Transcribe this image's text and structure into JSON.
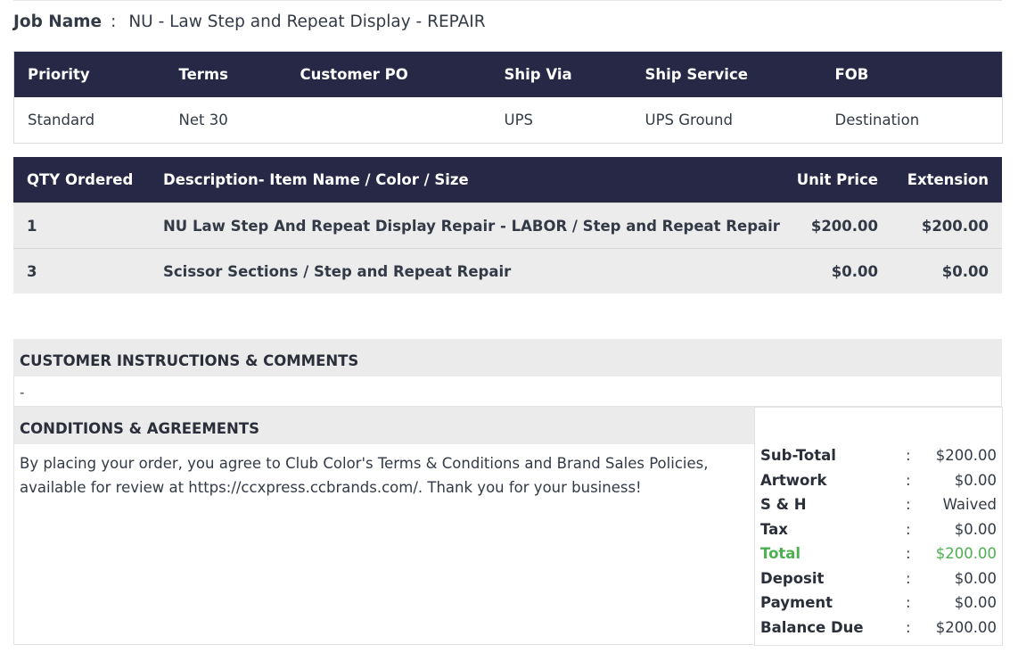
{
  "job": {
    "label": "Job Name",
    "colon": ":",
    "value": "NU - Law Step and Repeat Display - REPAIR"
  },
  "shipping": {
    "headers": [
      "Priority",
      "Terms",
      "Customer PO",
      "Ship Via",
      "Ship Service",
      "FOB"
    ],
    "values": [
      "Standard",
      "Net 30",
      "",
      "UPS",
      "UPS Ground",
      "Destination"
    ]
  },
  "items": {
    "headers": [
      "QTY Ordered",
      "Description- Item Name / Color / Size",
      "Unit Price",
      "Extension"
    ],
    "rows": [
      {
        "qty": "1",
        "description": "NU Law Step And Repeat Display Repair - LABOR / Step and Repeat Repair",
        "unit_price": "$200.00",
        "extension": "$200.00"
      },
      {
        "qty": "3",
        "description": "Scissor Sections / Step and Repeat Repair",
        "unit_price": "$0.00",
        "extension": "$0.00"
      }
    ]
  },
  "instructions": {
    "title": "CUSTOMER INSTRUCTIONS & COMMENTS",
    "text": "-"
  },
  "conditions": {
    "title": "CONDITIONS & AGREEMENTS",
    "text": "By placing your order, you agree to Club Color's Terms & Conditions and Brand Sales Policies, available for review at https://ccxpress.ccbrands.com/. Thank you for your business!"
  },
  "totals": [
    {
      "label": "Sub-Total",
      "colon": ":",
      "value": "$200.00"
    },
    {
      "label": "Artwork",
      "colon": ":",
      "value": "$0.00"
    },
    {
      "label": "S & H",
      "colon": ":",
      "value": "Waived"
    },
    {
      "label": "Tax",
      "colon": ":",
      "value": "$0.00"
    },
    {
      "label": "Total",
      "colon": ":",
      "value": "$200.00"
    },
    {
      "label": "Deposit",
      "colon": ":",
      "value": "$0.00"
    },
    {
      "label": "Payment",
      "colon": ":",
      "value": "$0.00"
    },
    {
      "label": "Balance Due",
      "colon": ":",
      "value": "$200.00"
    }
  ],
  "colors": {
    "header_bg": "#262845",
    "total_green": "#4caf50",
    "row_bg": "#ececec"
  }
}
